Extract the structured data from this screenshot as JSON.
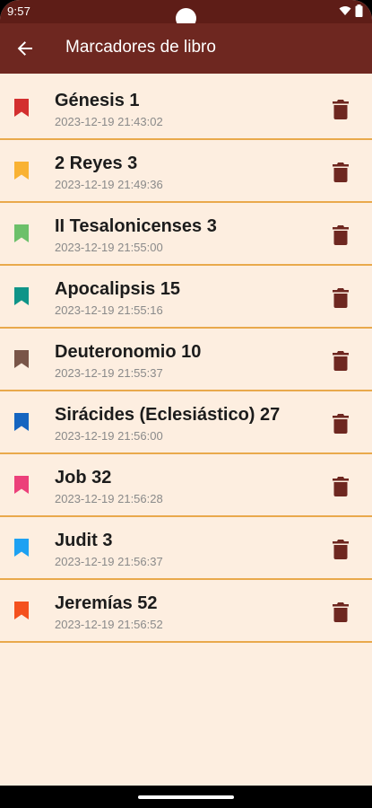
{
  "status_bar": {
    "time": "9:57"
  },
  "app_bar": {
    "title": "Marcadores de libro",
    "back_icon": "arrow-left-icon"
  },
  "colors": {
    "app_bar": "#6e2720",
    "status_bar": "#5e1d17",
    "background": "#fdeee0",
    "divider": "#e9a94c",
    "delete_icon": "#6e2720"
  },
  "bookmarks": [
    {
      "title": "Génesis 1",
      "date": "2023-12-19 21:43:02",
      "color": "#d32f2f"
    },
    {
      "title": "2 Reyes 3",
      "date": "2023-12-19 21:49:36",
      "color": "#f9b233"
    },
    {
      "title": "II Tesalonicenses 3",
      "date": "2023-12-19 21:55:00",
      "color": "#6cc06a"
    },
    {
      "title": "Apocalipsis 15",
      "date": "2023-12-19 21:55:16",
      "color": "#0f9488"
    },
    {
      "title": "Deuteronomio 10",
      "date": "2023-12-19 21:55:37",
      "color": "#795548"
    },
    {
      "title": "Sirácides (Eclesiástico) 27",
      "date": "2023-12-19 21:56:00",
      "color": "#1565c0"
    },
    {
      "title": "Job 32",
      "date": "2023-12-19 21:56:28",
      "color": "#ec407a"
    },
    {
      "title": "Judit 3",
      "date": "2023-12-19 21:56:37",
      "color": "#1da1f2"
    },
    {
      "title": "Jeremías 52",
      "date": "2023-12-19 21:56:52",
      "color": "#f4511e"
    }
  ]
}
